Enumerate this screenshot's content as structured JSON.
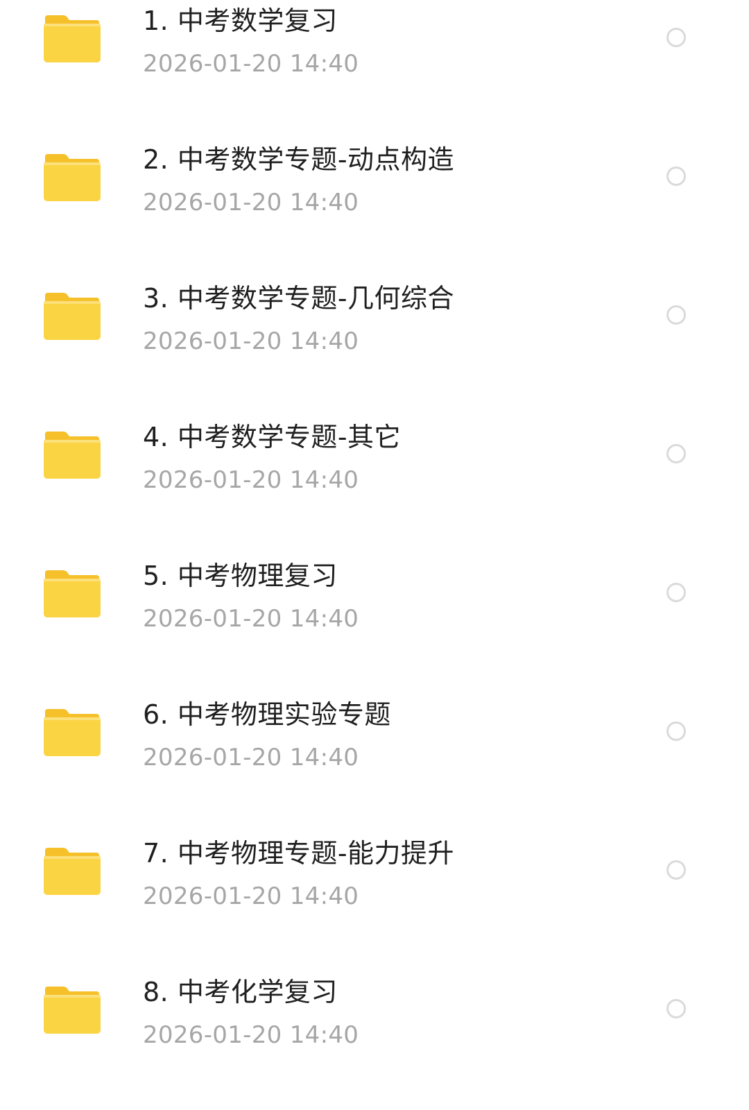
{
  "colors": {
    "folder_back": "#F6C02A",
    "folder_front": "#FBD444",
    "title_text": "#1F1F1F",
    "date_text": "#A6A6A6",
    "radio_border": "#DADADA"
  },
  "folders": [
    {
      "name": "1. 中考数学复习",
      "date": "2026-01-20  14:40",
      "icon": "folder-icon",
      "selected": false
    },
    {
      "name": "2. 中考数学专题-动点构造",
      "date": "2026-01-20  14:40",
      "icon": "folder-icon",
      "selected": false
    },
    {
      "name": "3. 中考数学专题-几何综合",
      "date": "2026-01-20  14:40",
      "icon": "folder-icon",
      "selected": false
    },
    {
      "name": "4. 中考数学专题-其它",
      "date": "2026-01-20  14:40",
      "icon": "folder-icon",
      "selected": false
    },
    {
      "name": "5. 中考物理复习",
      "date": "2026-01-20  14:40",
      "icon": "folder-icon",
      "selected": false
    },
    {
      "name": "6. 中考物理实验专题",
      "date": "2026-01-20  14:40",
      "icon": "folder-icon",
      "selected": false
    },
    {
      "name": "7. 中考物理专题-能力提升",
      "date": "2026-01-20  14:40",
      "icon": "folder-icon",
      "selected": false
    },
    {
      "name": "8. 中考化学复习",
      "date": "2026-01-20  14:40",
      "icon": "folder-icon",
      "selected": false
    }
  ]
}
